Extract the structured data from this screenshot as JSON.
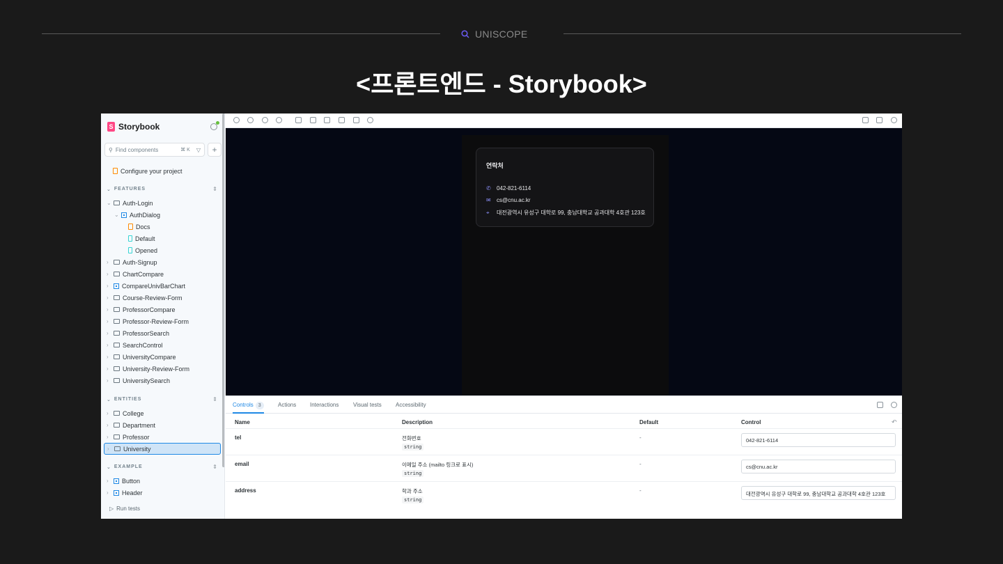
{
  "slide": {
    "brand": "UNISCOPE",
    "title": "<프론트엔드 -  Storybook>"
  },
  "sidebar": {
    "app_title": "Storybook",
    "search_placeholder": "Find components",
    "search_shortcut": "⌘ K",
    "configure": "Configure your project",
    "features_label": "FEATURES",
    "entities_label": "ENTITIES",
    "example_label": "EXAMPLE",
    "features": [
      {
        "label": "Auth-Login"
      },
      {
        "label": "AuthDialog"
      },
      {
        "label": "Docs"
      },
      {
        "label": "Default"
      },
      {
        "label": "Opened"
      },
      {
        "label": "Auth-Signup"
      },
      {
        "label": "ChartCompare"
      },
      {
        "label": "CompareUnivBarChart"
      },
      {
        "label": "Course-Review-Form"
      },
      {
        "label": "ProfessorCompare"
      },
      {
        "label": "Professor-Review-Form"
      },
      {
        "label": "ProfessorSearch"
      },
      {
        "label": "SearchControl"
      },
      {
        "label": "UniversityCompare"
      },
      {
        "label": "University-Review-Form"
      },
      {
        "label": "UniversitySearch"
      }
    ],
    "entities": [
      {
        "label": "College"
      },
      {
        "label": "Department"
      },
      {
        "label": "Professor"
      },
      {
        "label": "University"
      }
    ],
    "example": [
      {
        "label": "Button"
      },
      {
        "label": "Header"
      }
    ],
    "run_tests": "Run tests"
  },
  "preview": {
    "card_title": "연락처",
    "phone": "042-821-6114",
    "email": "cs@cnu.ac.kr",
    "address": "대전광역시 유성구 대학로 99, 충남대학교 공과대학 4호관 123호",
    "accent": "#8b8ff8"
  },
  "panel": {
    "tabs": [
      {
        "label": "Controls",
        "badge": "3"
      },
      {
        "label": "Actions"
      },
      {
        "label": "Interactions"
      },
      {
        "label": "Visual tests"
      },
      {
        "label": "Accessibility"
      }
    ],
    "headers": {
      "name": "Name",
      "description": "Description",
      "default": "Default",
      "control": "Control"
    },
    "rows": [
      {
        "name": "tel",
        "description": "전화번호",
        "type": "string",
        "default": "-",
        "control": "042-821-6114"
      },
      {
        "name": "email",
        "description": "이메일 주소 (mailto 링크로 표시)",
        "type": "string",
        "default": "-",
        "control": "cs@cnu.ac.kr"
      },
      {
        "name": "address",
        "description": "학과 주소",
        "type": "string",
        "default": "-",
        "control": "대전광역시 유성구 대학로 99, 충남대학교 공과대학 4호관 123호"
      }
    ]
  }
}
